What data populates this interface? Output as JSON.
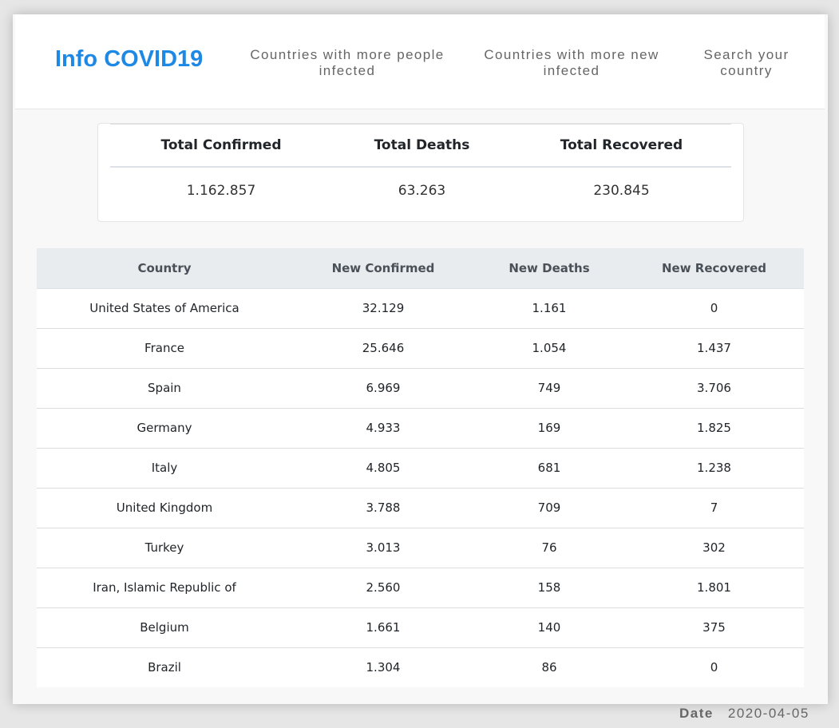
{
  "header": {
    "brand": "Info COVID19",
    "nav": [
      {
        "line1": "Countries with more people",
        "line2": "infected"
      },
      {
        "line1": "Countries with more new",
        "line2": "infected"
      },
      {
        "line1": "Search your",
        "line2": "country"
      }
    ]
  },
  "totals": {
    "headers": [
      "Total Confirmed",
      "Total Deaths",
      "Total Recovered"
    ],
    "values": [
      "1.162.857",
      "63.263",
      "230.845"
    ]
  },
  "table": {
    "columns": [
      "Country",
      "New Confirmed",
      "New Deaths",
      "New Recovered"
    ],
    "rows": [
      [
        "United States of America",
        "32.129",
        "1.161",
        "0"
      ],
      [
        "France",
        "25.646",
        "1.054",
        "1.437"
      ],
      [
        "Spain",
        "6.969",
        "749",
        "3.706"
      ],
      [
        "Germany",
        "4.933",
        "169",
        "1.825"
      ],
      [
        "Italy",
        "4.805",
        "681",
        "1.238"
      ],
      [
        "United Kingdom",
        "3.788",
        "709",
        "7"
      ],
      [
        "Turkey",
        "3.013",
        "76",
        "302"
      ],
      [
        "Iran, Islamic Republic of",
        "2.560",
        "158",
        "1.801"
      ],
      [
        "Belgium",
        "1.661",
        "140",
        "375"
      ],
      [
        "Brazil",
        "1.304",
        "86",
        "0"
      ]
    ]
  },
  "footer": {
    "date_label": "Date",
    "date_value": "2020-04-05"
  },
  "colors": {
    "brand": "#1e88e5",
    "table_header_bg": "#e9ecef",
    "nav_text": "#666666"
  }
}
